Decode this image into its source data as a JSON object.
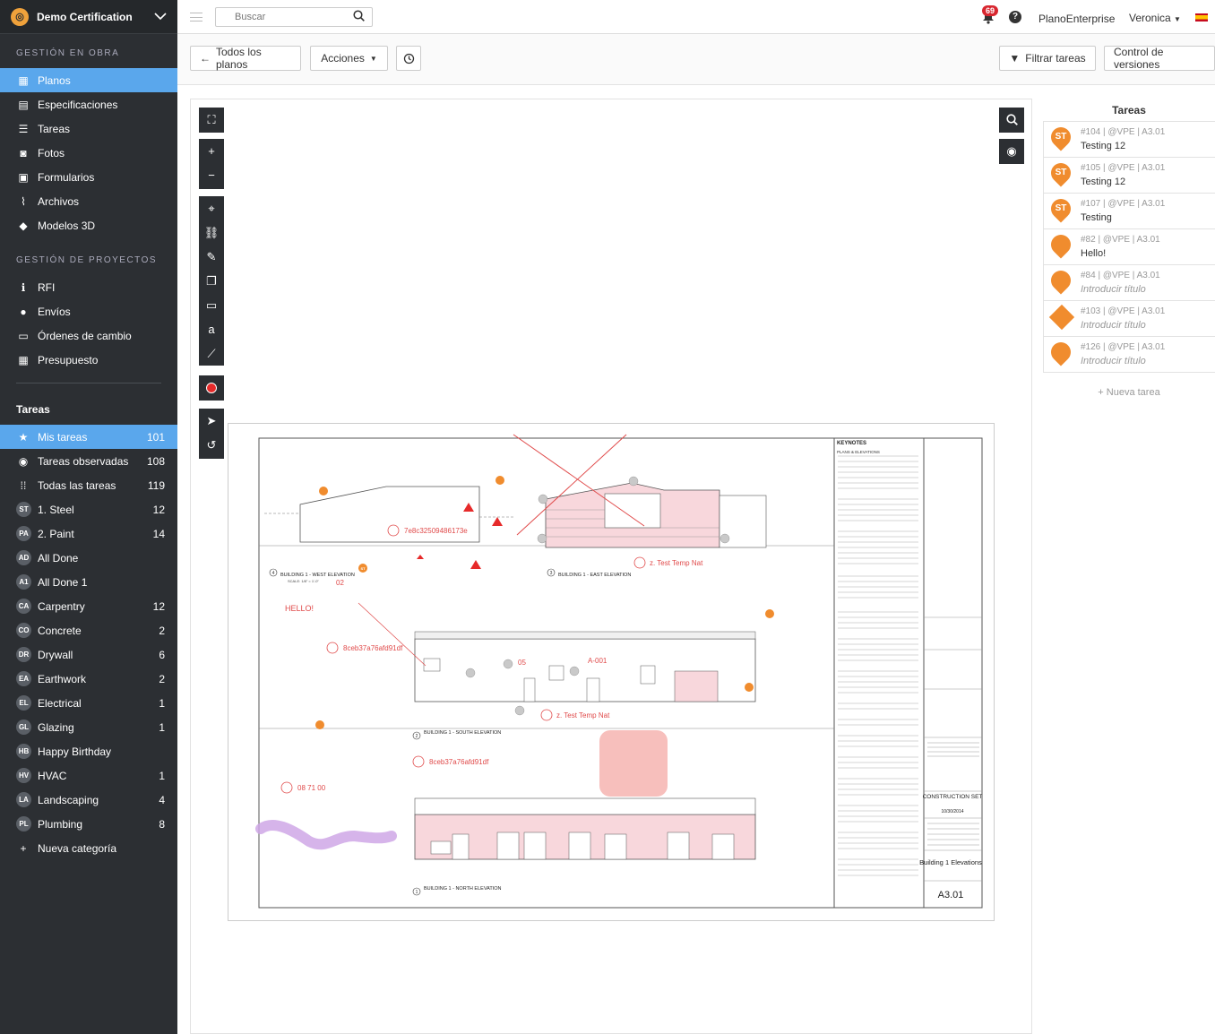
{
  "sidebar": {
    "brand": "Demo Certification",
    "sections": {
      "obra": "GESTIÓN EN OBRA",
      "proyectos": "GESTIÓN DE PROYECTOS",
      "tareas": "Tareas"
    },
    "obra_items": [
      "Planos",
      "Especificaciones",
      "Tareas",
      "Fotos",
      "Formularios",
      "Archivos",
      "Modelos 3D"
    ],
    "proyectos_items": [
      "RFI",
      "Envíos",
      "Órdenes de cambio",
      "Presupuesto"
    ],
    "task_filters": [
      {
        "label": "Mis tareas",
        "count": "101"
      },
      {
        "label": "Tareas observadas",
        "count": "108"
      },
      {
        "label": "Todas las tareas",
        "count": "119"
      }
    ],
    "categories": [
      {
        "badge": "ST",
        "label": "1. Steel",
        "count": "12"
      },
      {
        "badge": "PA",
        "label": "2. Paint",
        "count": "14"
      },
      {
        "badge": "AD",
        "label": "All Done",
        "count": ""
      },
      {
        "badge": "A1",
        "label": "All Done 1",
        "count": ""
      },
      {
        "badge": "CA",
        "label": "Carpentry",
        "count": "12"
      },
      {
        "badge": "CO",
        "label": "Concrete",
        "count": "2"
      },
      {
        "badge": "DR",
        "label": "Drywall",
        "count": "6"
      },
      {
        "badge": "EA",
        "label": "Earthwork",
        "count": "2"
      },
      {
        "badge": "EL",
        "label": "Electrical",
        "count": "1"
      },
      {
        "badge": "GL",
        "label": "Glazing",
        "count": "1"
      },
      {
        "badge": "HB",
        "label": "Happy Birthday",
        "count": ""
      },
      {
        "badge": "HV",
        "label": "HVAC",
        "count": "1"
      },
      {
        "badge": "LA",
        "label": "Landscaping",
        "count": "4"
      },
      {
        "badge": "PL",
        "label": "Plumbing",
        "count": "8"
      }
    ],
    "new_category": "Nueva categoría"
  },
  "topbar": {
    "search_placeholder": "Buscar",
    "notifications": "69",
    "help": "?",
    "enterprise": "PlanoEnterprise",
    "user": "Veronica"
  },
  "toolbar": {
    "all_plans": "Todos los planos",
    "actions": "Acciones",
    "filter_tasks": "Filtrar tareas",
    "version_control": "Control de versiones"
  },
  "tasks_panel": {
    "title": "Tareas",
    "new_task": "+ Nueva tarea",
    "items": [
      {
        "badge": "ST",
        "shape": "pin",
        "meta": "#104 | @VPE | A3.01",
        "title": "Testing 12",
        "placeholder": false
      },
      {
        "badge": "ST",
        "shape": "pin",
        "meta": "#105 | @VPE | A3.01",
        "title": "Testing 12",
        "placeholder": false
      },
      {
        "badge": "ST",
        "shape": "pin",
        "meta": "#107 | @VPE | A3.01",
        "title": "Testing",
        "placeholder": false
      },
      {
        "badge": "",
        "shape": "pin",
        "meta": "#82 | @VPE | A3.01",
        "title": "Hello!",
        "placeholder": false
      },
      {
        "badge": "",
        "shape": "pin",
        "meta": "#84 | @VPE | A3.01",
        "title": "Introducir título",
        "placeholder": true
      },
      {
        "badge": "",
        "shape": "diamond",
        "meta": "#103 | @VPE | A3.01",
        "title": "Introducir título",
        "placeholder": true
      },
      {
        "badge": "",
        "shape": "pin",
        "meta": "#126 | @VPE | A3.01",
        "title": "Introducir título",
        "placeholder": true
      }
    ]
  },
  "drawing": {
    "keynotes": "KEYNOTES",
    "plans_elevations": "PLANS & ELEVATIONS",
    "labels": {
      "west": "BUILDING 1 - WEST ELEVATION",
      "east": "BUILDING 1 - EAST ELEVATION",
      "south": "BUILDING 1 - SOUTH ELEVATION",
      "north": "BUILDING 1 - NORTH ELEVATION",
      "scale": "SCALE: 1/8\" = 1'-0\"",
      "num_west": "4",
      "num_east": "3",
      "num_south": "2",
      "num_north": "1",
      "sheet_ref": "A3.01"
    },
    "annotations": {
      "hash1": "7e8c32509486173e",
      "hash2": "8ceb37a76afd91df",
      "hash3": "8ceb37a76afd91df",
      "temp1": "z. Test Temp Nat",
      "temp2": "z. Test Temp Nat",
      "hello": "HELLO!",
      "code": "08 71 00",
      "n02": "02",
      "n05": "05",
      "a001": "A-001",
      "st": "ST"
    },
    "title_block": {
      "set_name": "CONSTRUCTION SET",
      "date": "10/30/2014",
      "sheet_title": "Building 1 Elevations",
      "sheet_number": "A3.01"
    }
  }
}
